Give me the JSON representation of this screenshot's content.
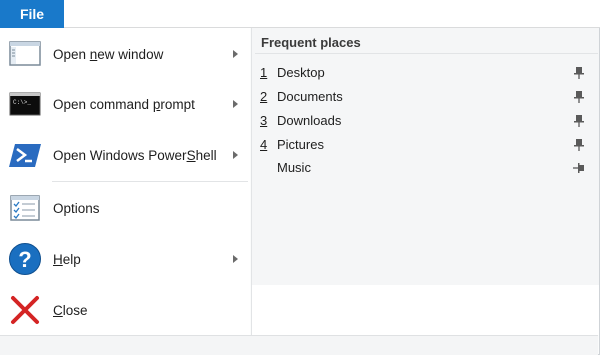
{
  "file_tab": {
    "label": "File"
  },
  "menu": {
    "open_new_window": {
      "pre": "Open ",
      "u": "n",
      "post": "ew window"
    },
    "open_command_prompt": {
      "pre": "Open command ",
      "u": "p",
      "post": "rompt"
    },
    "open_powershell": {
      "pre": "Open Windows Power",
      "u": "S",
      "post": "hell"
    },
    "options": {
      "pre": "Options",
      "u": "",
      "post": ""
    },
    "help": {
      "pre": "",
      "u": "H",
      "post": "elp"
    },
    "close": {
      "pre": "",
      "u": "C",
      "post": "lose"
    }
  },
  "frequent_places": {
    "header": "Frequent places",
    "items": [
      {
        "num": "1",
        "name": "Desktop",
        "pinned": true
      },
      {
        "num": "2",
        "name": "Documents",
        "pinned": true
      },
      {
        "num": "3",
        "name": "Downloads",
        "pinned": true
      },
      {
        "num": "4",
        "name": "Pictures",
        "pinned": true
      },
      {
        "num": "",
        "name": "Music",
        "pinned": false
      }
    ]
  },
  "colors": {
    "accent": "#1979ca",
    "help_blue": "#1a6fc0",
    "close_red": "#d42424"
  }
}
